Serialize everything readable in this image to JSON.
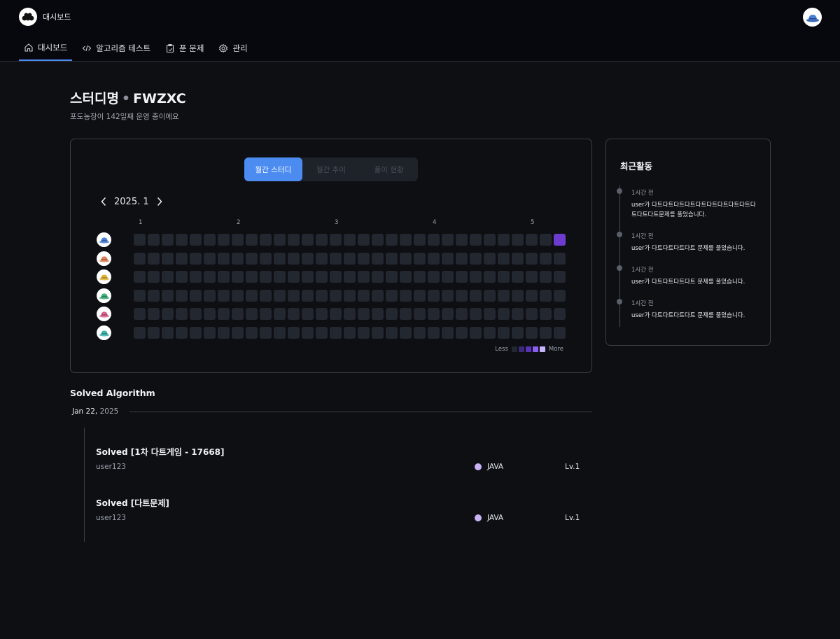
{
  "header": {
    "brand": "대시보드",
    "nav": [
      {
        "label": "대시보드",
        "icon": "home-icon"
      },
      {
        "label": "알고리즘 테스트",
        "icon": "code-icon"
      },
      {
        "label": "푼 문제",
        "icon": "clipboard-icon"
      },
      {
        "label": "관리",
        "icon": "gear-icon"
      }
    ]
  },
  "study": {
    "name": "스터디명",
    "code": "FWZXC",
    "subtitle": "포도농장이 142일째 운영 중이에요"
  },
  "tabs": [
    "월간 스터디",
    "월간 추이",
    "풀이 현황"
  ],
  "calendar": {
    "month": "2025. 1",
    "week_labels": [
      "1",
      "2",
      "3",
      "4",
      "5"
    ],
    "legend_less": "Less",
    "legend_more": "More",
    "legend_colors": [
      "#23272f",
      "#3d2a7a",
      "#5a33b5",
      "#8a5ff0",
      "#c8b3ff"
    ],
    "members": [
      {
        "hat_color": "#4a7fd6",
        "levels": [
          0,
          0,
          0,
          0,
          0,
          0,
          0,
          0,
          0,
          0,
          0,
          0,
          0,
          0,
          0,
          0,
          0,
          0,
          0,
          0,
          0,
          0,
          0,
          0,
          0,
          0,
          0,
          0,
          0,
          0,
          4
        ]
      },
      {
        "hat_color": "#e0805a",
        "levels": [
          0,
          0,
          0,
          0,
          0,
          0,
          0,
          0,
          0,
          0,
          0,
          0,
          0,
          0,
          0,
          0,
          0,
          0,
          0,
          0,
          0,
          0,
          0,
          0,
          0,
          0,
          0,
          0,
          0,
          0,
          0
        ]
      },
      {
        "hat_color": "#e2b53a",
        "levels": [
          0,
          0,
          0,
          0,
          0,
          0,
          0,
          0,
          0,
          0,
          0,
          0,
          0,
          0,
          0,
          0,
          0,
          0,
          0,
          0,
          0,
          0,
          0,
          0,
          0,
          0,
          0,
          0,
          0,
          0,
          0
        ]
      },
      {
        "hat_color": "#3fae7a",
        "levels": [
          0,
          0,
          0,
          0,
          0,
          0,
          0,
          0,
          0,
          0,
          0,
          0,
          0,
          0,
          0,
          0,
          0,
          0,
          0,
          0,
          0,
          0,
          0,
          0,
          0,
          0,
          0,
          0,
          0,
          0,
          0
        ]
      },
      {
        "hat_color": "#d9658f",
        "levels": [
          0,
          0,
          0,
          0,
          0,
          0,
          0,
          0,
          0,
          0,
          0,
          0,
          0,
          0,
          0,
          0,
          0,
          0,
          0,
          0,
          0,
          0,
          0,
          0,
          0,
          0,
          0,
          0,
          0,
          0,
          0
        ]
      },
      {
        "hat_color": "#3fb3b0",
        "levels": [
          0,
          0,
          0,
          0,
          0,
          0,
          0,
          0,
          0,
          0,
          0,
          0,
          0,
          0,
          0,
          0,
          0,
          0,
          0,
          0,
          0,
          0,
          0,
          0,
          0,
          0,
          0,
          0,
          0,
          0,
          0
        ]
      }
    ]
  },
  "activity": {
    "title": "최근활동",
    "items": [
      {
        "time": "1시간 전",
        "text": "user가 다트다트다트다트다트다트다트다트다트다트다트다트문제를 풀었습니다."
      },
      {
        "time": "1시간 전",
        "text": "user가 다트다트다트다트 문제를 풀었습니다."
      },
      {
        "time": "1시간 전",
        "text": "user가 다트다트다트다트 문제를 풀었습니다."
      },
      {
        "time": "1시간 전",
        "text": "user가 다트다트다트다트 문제를 풀었습니다."
      }
    ]
  },
  "solved": {
    "title": "Solved Algorithm",
    "date": "Jan 22,",
    "year": "2025",
    "items": [
      {
        "title": "Solved [1차 다트게임 - 17668]",
        "user": "user123",
        "lang": "JAVA",
        "lang_color": "#c9b2f5",
        "level": "Lv.1"
      },
      {
        "title": "Solved [다트문제]",
        "user": "user123",
        "lang": "JAVA",
        "lang_color": "#c9b2f5",
        "level": "Lv.1"
      }
    ]
  },
  "colors": {
    "accent": "#4c8cf0",
    "active_cell": "#6d3ccf"
  }
}
